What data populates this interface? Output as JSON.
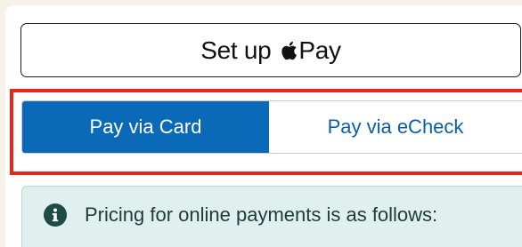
{
  "apple_pay": {
    "label_prefix": "Set up",
    "label_suffix": "Pay",
    "icon": "apple-logo-icon"
  },
  "payment_tabs": {
    "items": [
      {
        "label": "Pay via Card",
        "selected": true
      },
      {
        "label": "Pay via eCheck",
        "selected": false
      }
    ]
  },
  "info": {
    "icon": "info-circle-icon",
    "text": "Pricing for online payments is as follows:"
  },
  "colors": {
    "selected_tab": "#0b6ab8",
    "highlight_border": "#e8261b",
    "info_background": "#dff0ee"
  }
}
